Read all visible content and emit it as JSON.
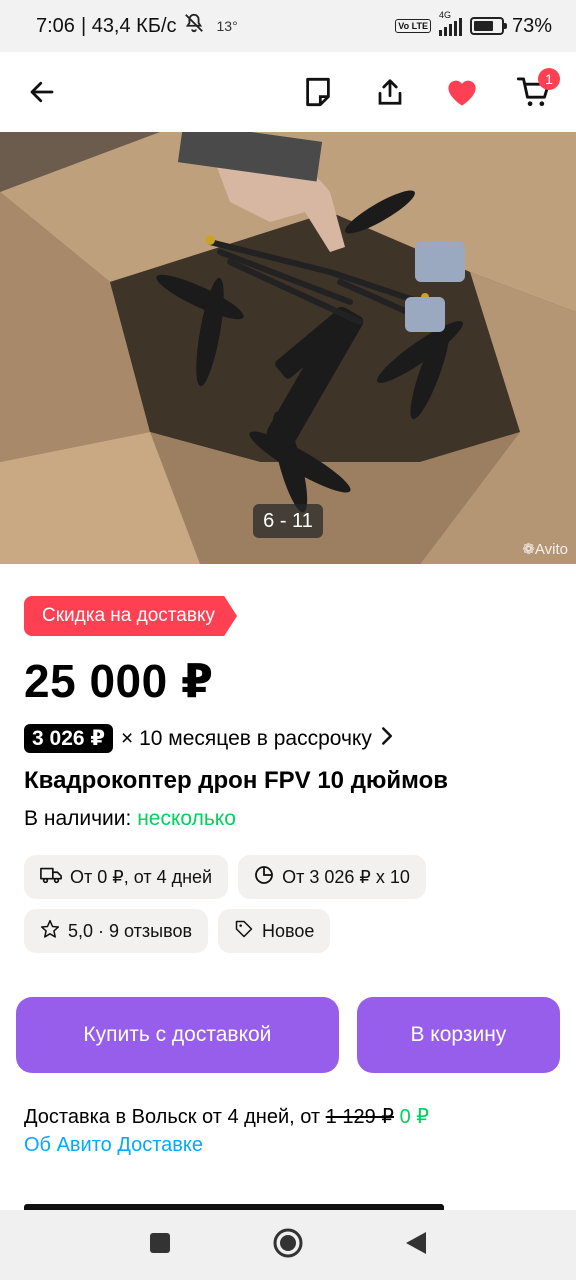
{
  "status": {
    "time": "7:06",
    "speed": "| 43,4 КБ/с",
    "temp": "13°",
    "network": "4G",
    "volte": "Vo LTE",
    "battery": "73%",
    "battery_level": 0.73
  },
  "header": {
    "back_icon": "arrow-left-icon",
    "note_icon": "note-icon",
    "share_icon": "share-icon",
    "favorite_icon": "heart-icon",
    "cart_icon": "cart-icon",
    "cart_count": "1",
    "heart_color": "#ff4053"
  },
  "gallery": {
    "counter": "6 - 11",
    "watermark": "Avito"
  },
  "listing": {
    "promo": "Скидка на доставку",
    "price": "25 000 ₽",
    "installment_amount": "3 026 ₽",
    "installment_text": "× 10 месяцев в рассрочку",
    "title": "Квадрокоптер дрон FPV 10 дюймов",
    "stock_label": "В наличии:",
    "stock_value": "несколько"
  },
  "chips": {
    "delivery": "От 0 ₽, от 4 дней",
    "installment": "От 3 026 ₽ x 10",
    "rating": "5,0 · 9 отзывов",
    "condition": "Новое"
  },
  "actions": {
    "buy": "Купить с доставкой",
    "cart": "В корзину",
    "accent": "#965eeb"
  },
  "delivery": {
    "text": "Доставка в Вольск от 4 дней, от",
    "old_price": "1 129 ₽",
    "new_price": "0 ₽",
    "link": "Об Авито Доставке"
  },
  "colors": {
    "green": "#02d15c",
    "link": "#00aaff",
    "promo": "#ff4053"
  }
}
